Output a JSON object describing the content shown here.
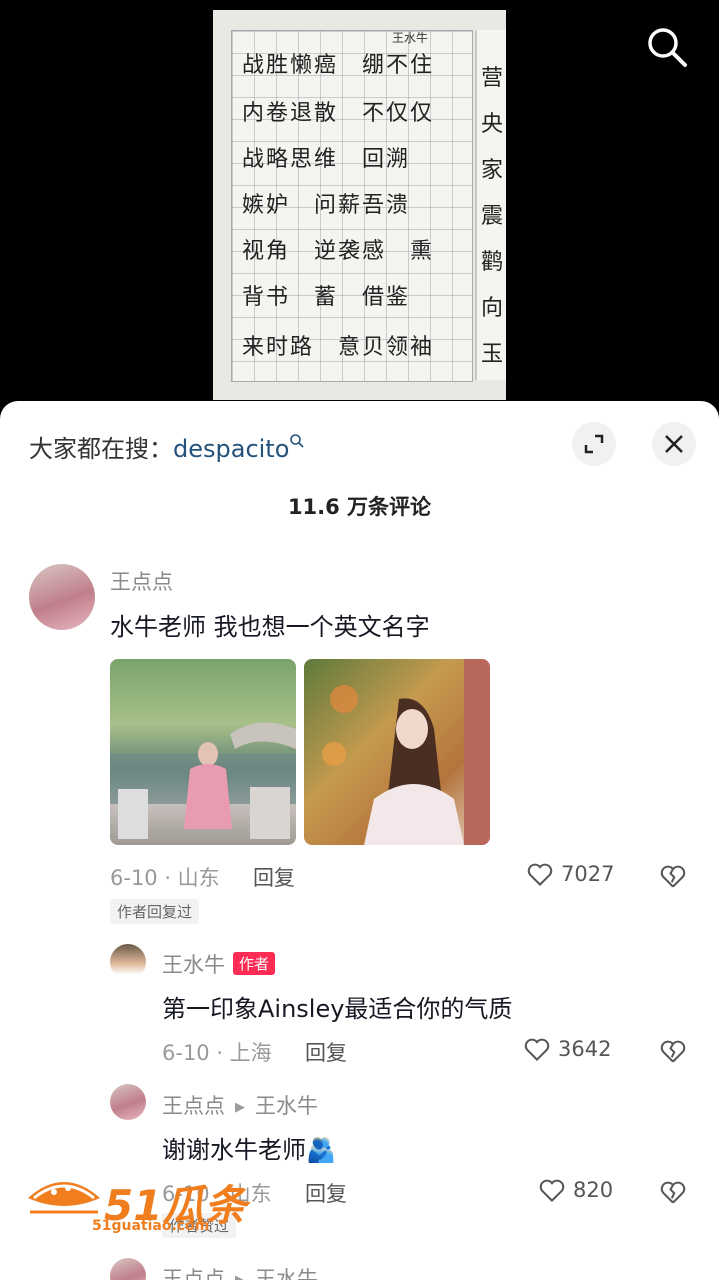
{
  "video": {
    "notebook_name": "王水牛",
    "lines": [
      "战胜懒癌　绷不住",
      "内卷退散　不仅仅",
      "战略思维　回溯",
      "嫉妒　问薪吾溃",
      "视角　逆袭感　熏",
      "背书　蓄　借鉴",
      "来时路　意贝领袖"
    ],
    "right_lines": [
      "营",
      "央",
      "家",
      "震",
      "鹳",
      "向",
      "玉"
    ]
  },
  "icons": {
    "search": "search-icon",
    "expand": "expand-icon",
    "close": "close-icon",
    "heart": "heart-icon",
    "dislike": "broken-heart-icon"
  },
  "sheet": {
    "search_prefix": "大家都在搜：",
    "search_term": "despacito",
    "comment_count": "11.6 万条评论"
  },
  "comments": [
    {
      "user": "王点点",
      "text": "水牛老师 我也想一个英文名字",
      "meta": "6-10 · 山东",
      "reply": "回复",
      "likes": "7027",
      "tag": "作者回复过"
    }
  ],
  "replies": [
    {
      "user": "王水牛",
      "badge": "作者",
      "text": "第一印象Ainsley最适合你的气质",
      "meta": "6-10 · 上海",
      "reply": "回复",
      "likes": "3642"
    },
    {
      "user": "王点点",
      "target": "王水牛",
      "text": "谢谢水牛老师🫂",
      "meta": "6-10 · 山东",
      "reply": "回复",
      "likes": "820",
      "tag": "作者赞过"
    },
    {
      "user": "王点点",
      "target": "王水牛"
    }
  ],
  "watermark": {
    "main": "51瓜条",
    "sub": "51guatiao.com"
  },
  "colors": {
    "accent": "#fe2c55",
    "link": "#24527a",
    "watermark": "#f07e1e"
  }
}
